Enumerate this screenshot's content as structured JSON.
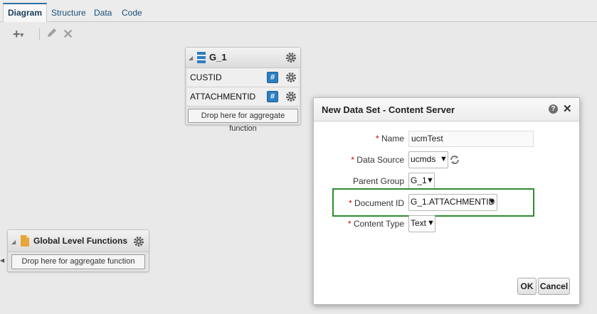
{
  "tabs": [
    {
      "label": "Diagram",
      "active": true
    },
    {
      "label": "Structure",
      "active": false
    },
    {
      "label": "Data",
      "active": false
    },
    {
      "label": "Code",
      "active": false
    }
  ],
  "toolbar": {
    "add_icon": "plus-icon",
    "edit_icon": "pencil-icon",
    "delete_icon": "x-icon"
  },
  "group_g1": {
    "title": "G_1",
    "rows": [
      {
        "label": "CUSTID"
      },
      {
        "label": "ATTACHMENTID"
      }
    ],
    "drop_label": "Drop here for aggregate function"
  },
  "global_functions": {
    "title": "Global Level Functions",
    "drop_label": "Drop here for aggregate function"
  },
  "dialog": {
    "title": "New Data Set - Content Server",
    "fields": {
      "name": {
        "label": "Name",
        "value": "ucmTest",
        "required": true
      },
      "data_source": {
        "label": "Data Source",
        "value": "ucmds",
        "required": true
      },
      "parent_group": {
        "label": "Parent Group",
        "value": "G_1",
        "required": false
      },
      "document_id": {
        "label": "Document ID",
        "value": "G_1.ATTACHMENTID",
        "required": true
      },
      "content_type": {
        "label": "Content Type",
        "value": "Text",
        "required": true
      }
    },
    "ok_label": "OK",
    "cancel_label": "Cancel"
  },
  "colors": {
    "accent": "#2f6da3",
    "highlight_border": "#2e8b2e",
    "required_star": "#cc0000"
  }
}
